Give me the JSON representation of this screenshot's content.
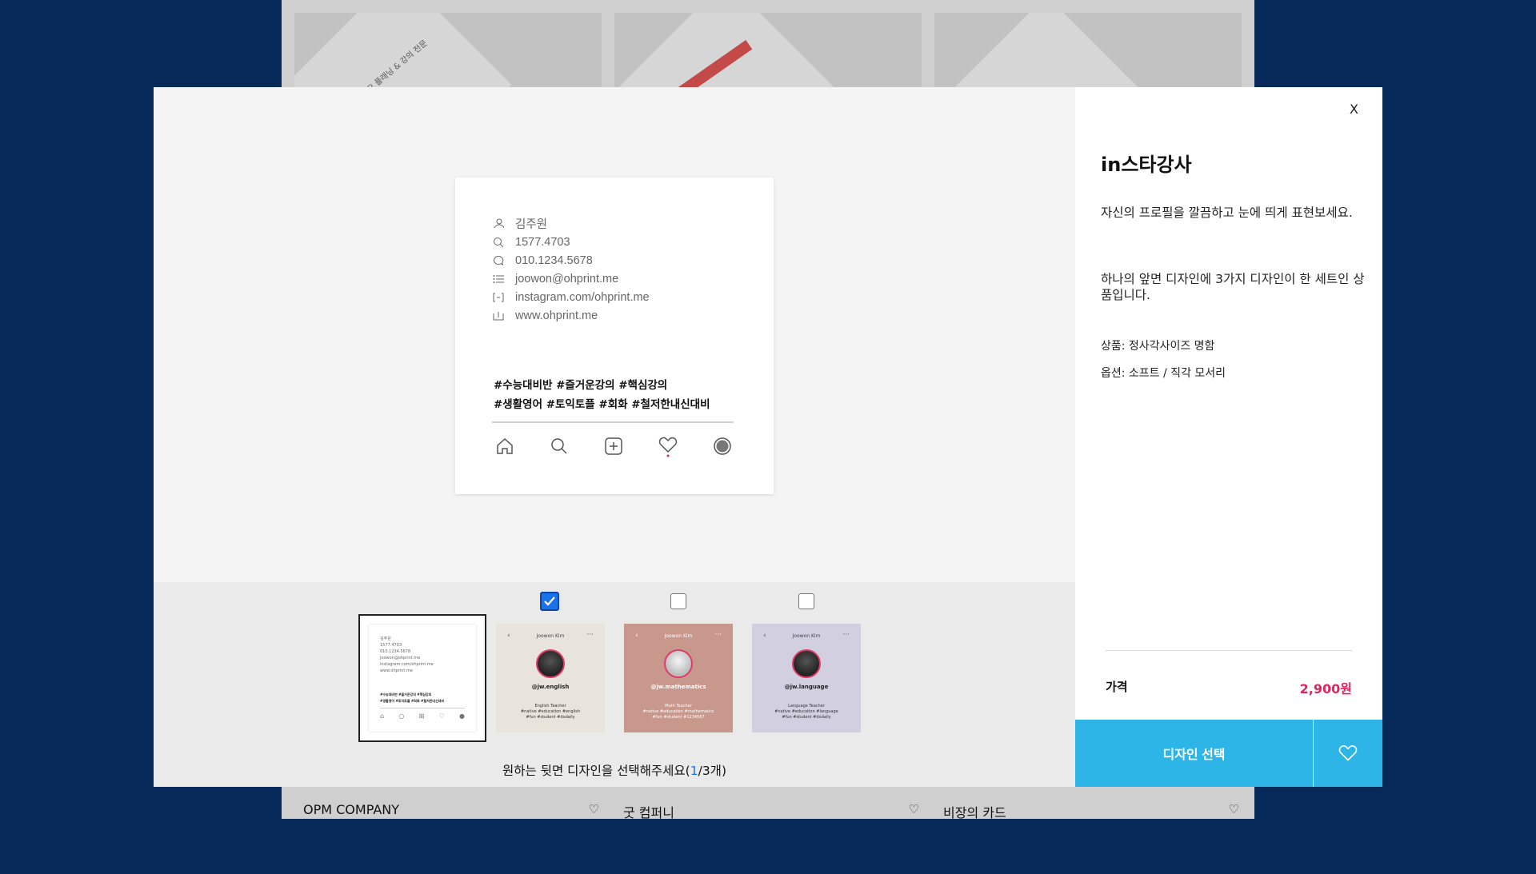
{
  "background": {
    "cards": [
      {
        "text": "포트폴리오 플래닝 & 강의 전문"
      },
      {
        "text": ""
      },
      {
        "text": ""
      }
    ],
    "items": [
      {
        "name": "OPM COMPANY"
      },
      {
        "name": "굿 컴퍼니"
      },
      {
        "name": "비장의 카드"
      }
    ]
  },
  "preview": {
    "contacts": [
      {
        "icon": "person-icon",
        "text": "김주원"
      },
      {
        "icon": "search-icon",
        "text": "1577.4703"
      },
      {
        "icon": "speech-bubble-icon",
        "text": "010.1234.5678"
      },
      {
        "icon": "list-icon",
        "text": "joowon@ohprint.me"
      },
      {
        "icon": "tag-icon",
        "text": "instagram.com/ohprint.me"
      },
      {
        "icon": "bracket-icon",
        "text": "www.ohprint.me"
      }
    ],
    "hashtags_line1": "#수능대비반 #즐거운강의 #핵심강의",
    "hashtags_line2": "#생활영어 #토익토플 #회화 #철저한내신대비"
  },
  "thumbnails": {
    "items": [
      {
        "checked": true,
        "bg": "#e8e4dc",
        "head": "Joowon Kim",
        "handle": "@jw.english",
        "line1": "English Teacher",
        "line2": "#native #education #english",
        "line3": "#fun #student #dodaily"
      },
      {
        "checked": false,
        "bg": "#c9988c",
        "head": "Joowon Kim",
        "handle": "@jw.mathematics",
        "line1": "Math Teacher",
        "line2": "#native #education #mathematics",
        "line3": "#fun #student #1234567"
      },
      {
        "checked": false,
        "bg": "#d2cfe0",
        "head": "Joowon Kim",
        "handle": "@jw.language",
        "line1": "Language Teacher",
        "line2": "#native #education #language",
        "line3": "#fun #student #dodaily"
      }
    ],
    "caption_prefix": "원하는 뒷면 디자인을 선택해주세요(",
    "caption_current": "1",
    "caption_suffix": "/3개)"
  },
  "panel": {
    "close": "X",
    "title": "in스타강사",
    "description1": "자신의 프로필을 깔끔하고 눈에 띄게 표현보세요.",
    "description2": "하나의 앞면 디자인에 3가지 디자인이 한 세트인 상품입니다.",
    "spec_product": "상품: 정사각사이즈 명함",
    "spec_option": "옵션: 소프트 / 직각 모서리",
    "price_label": "가격",
    "price_value": "2,900원",
    "select_button": "디자인 선택"
  },
  "colors": {
    "page_background": "#06295a",
    "accent": "#2cb5e6",
    "price": "#e0245e",
    "checkbox": "#1a73e8"
  }
}
